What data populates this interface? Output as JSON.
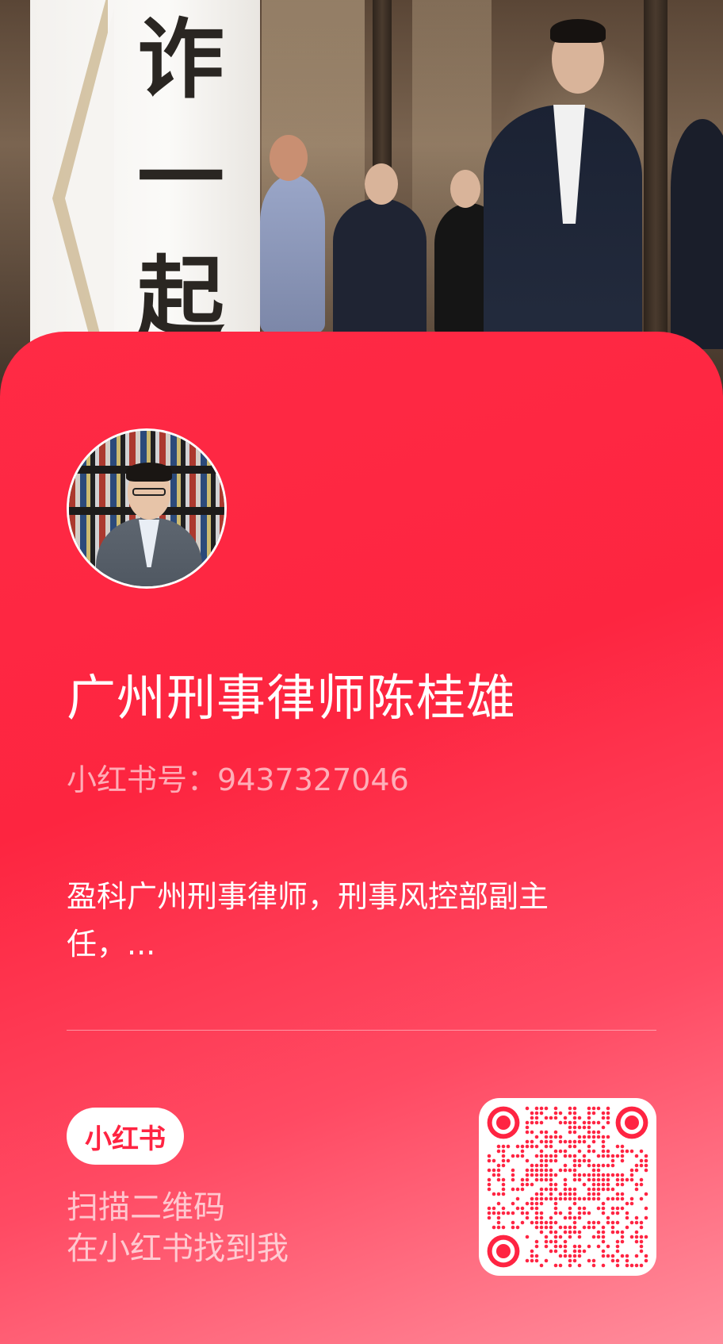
{
  "background_photo": {
    "description_icon": "event-photo",
    "banner_calligraphy": [
      "诈",
      "一",
      "起"
    ]
  },
  "profile": {
    "avatar_icon": "profile-avatar",
    "name": "广州刑事律师陈桂雄",
    "account_label": "小红书号：",
    "account_id": "9437327046",
    "bio_line1": "盈科广州刑事律师，刑事风控部副主",
    "bio_line2": "任，..."
  },
  "footer": {
    "logo_text": "小红书",
    "scan_line1": "扫描二维码",
    "scan_line2": "在小红书找到我",
    "qr_icon": "qr-code-icon"
  },
  "colors": {
    "card_red": "#ff2442",
    "card_pink": "#ff8d9c",
    "white": "#ffffff"
  }
}
